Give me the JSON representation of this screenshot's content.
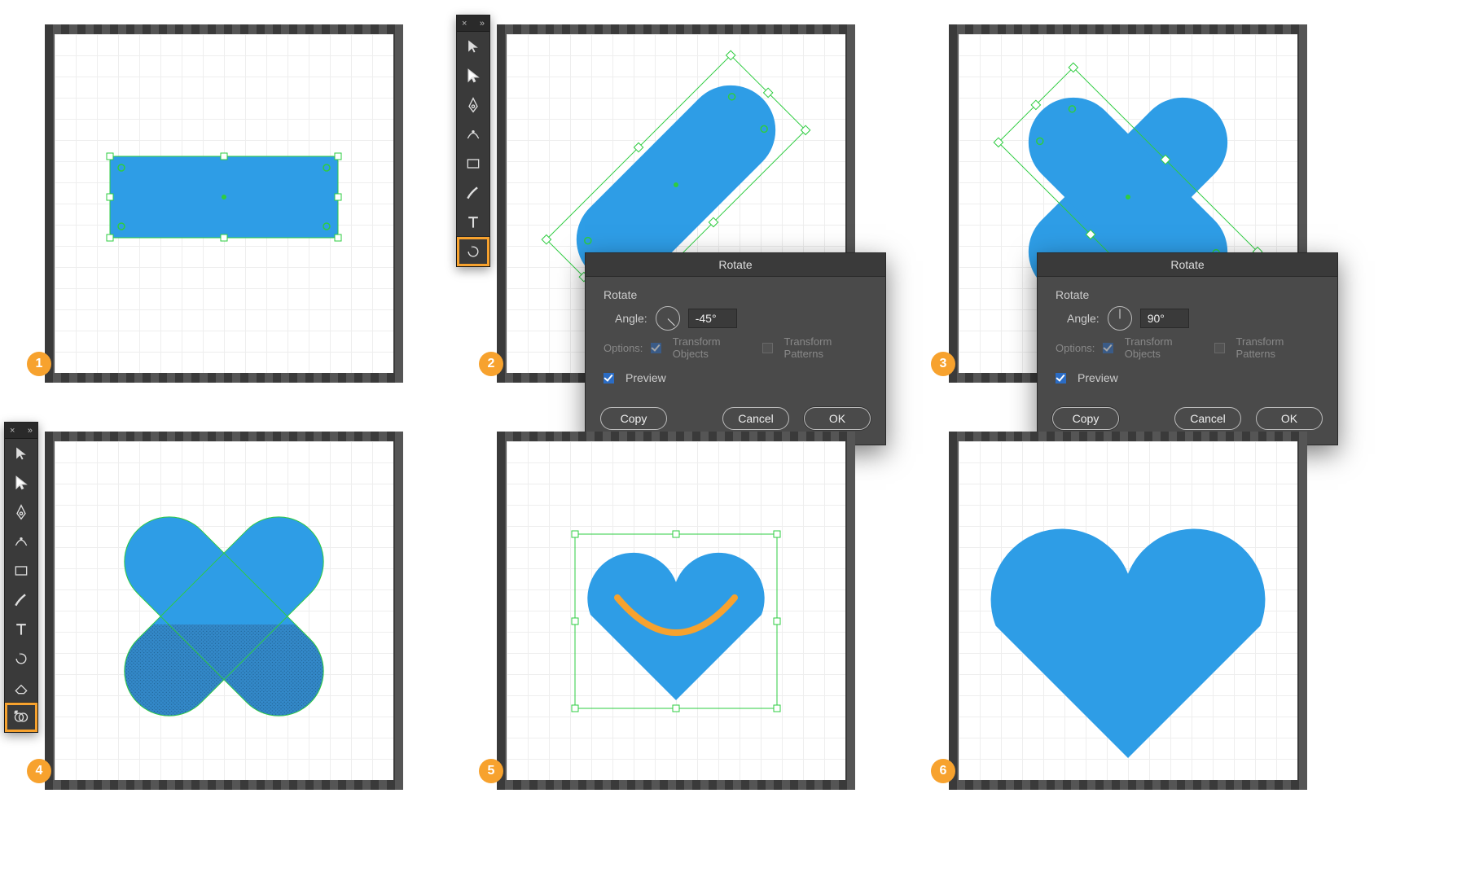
{
  "steps": [
    "1",
    "2",
    "3",
    "4",
    "5",
    "6"
  ],
  "toolbar2": {
    "close": "×",
    "collapse": "»",
    "tools": [
      {
        "name": "selection-tool-icon"
      },
      {
        "name": "direct-selection-tool-icon"
      },
      {
        "name": "pen-tool-icon"
      },
      {
        "name": "curvature-tool-icon"
      },
      {
        "name": "rectangle-tool-icon"
      },
      {
        "name": "brush-tool-icon"
      },
      {
        "name": "type-tool-icon"
      },
      {
        "name": "rotate-tool-icon",
        "highlighted": true
      }
    ]
  },
  "toolbar4": {
    "close": "×",
    "collapse": "»",
    "tools": [
      {
        "name": "selection-tool-icon"
      },
      {
        "name": "direct-selection-tool-icon"
      },
      {
        "name": "pen-tool-icon"
      },
      {
        "name": "curvature-tool-icon"
      },
      {
        "name": "rectangle-tool-icon"
      },
      {
        "name": "brush-tool-icon"
      },
      {
        "name": "type-tool-icon"
      },
      {
        "name": "rotate-tool-icon"
      },
      {
        "name": "eraser-tool-icon"
      },
      {
        "name": "shape-builder-tool-icon",
        "highlighted": true
      }
    ]
  },
  "dialog2": {
    "title": "Rotate",
    "section": "Rotate",
    "angle_label": "Angle:",
    "angle_value": "-45°",
    "options_label": "Options:",
    "transform_objects": "Transform Objects",
    "transform_patterns": "Transform Patterns",
    "preview": "Preview",
    "copy": "Copy",
    "cancel": "Cancel",
    "ok": "OK",
    "highlight": "ok"
  },
  "dialog3": {
    "title": "Rotate",
    "section": "Rotate",
    "angle_label": "Angle:",
    "angle_value": "90°",
    "options_label": "Options:",
    "transform_objects": "Transform Objects",
    "transform_patterns": "Transform Patterns",
    "preview": "Preview",
    "copy": "Copy",
    "cancel": "Cancel",
    "ok": "OK",
    "highlight": "copy"
  }
}
